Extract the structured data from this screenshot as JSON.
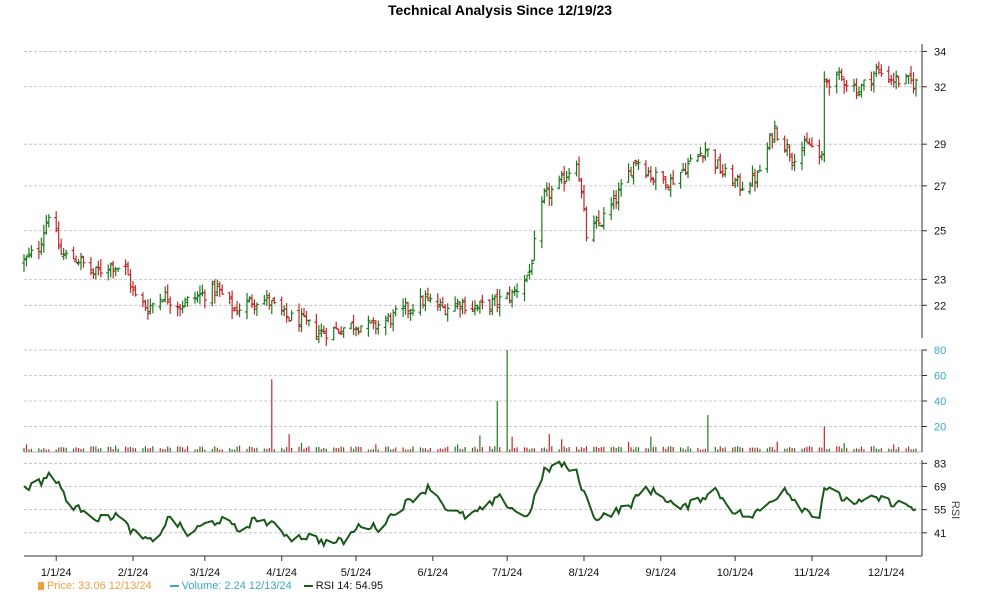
{
  "chart_data": {
    "type": "line",
    "title": "Technical Analysis Since 12/19/23",
    "x_tick_labels": [
      "1/1/24",
      "2/1/24",
      "3/1/24",
      "4/1/24",
      "5/1/24",
      "6/1/24",
      "7/1/24",
      "8/1/24",
      "9/1/24",
      "10/1/24",
      "11/1/24",
      "12/1/24"
    ],
    "price_panel": {
      "type": "ohlc",
      "y_scale": "log",
      "y_ticks": [
        22,
        23,
        25,
        27,
        29,
        32,
        34
      ],
      "ylim": [
        20.8,
        34.2
      ],
      "up_color": "#1f7a1f",
      "down_color": "#c0282a",
      "anchors": [
        [
          "12/19/23",
          23.7
        ],
        [
          "12/25/23",
          24.3
        ],
        [
          "12/29/23",
          25.8
        ],
        [
          "1/3/24",
          24.0
        ],
        [
          "1/10/24",
          23.8
        ],
        [
          "1/16/24",
          23.2
        ],
        [
          "1/23/24",
          23.6
        ],
        [
          "1/29/24",
          23.4
        ],
        [
          "2/2/24",
          22.3
        ],
        [
          "2/7/24",
          21.9
        ],
        [
          "2/13/24",
          22.4
        ],
        [
          "2/20/24",
          22.0
        ],
        [
          "2/28/24",
          22.4
        ],
        [
          "3/6/24",
          22.6
        ],
        [
          "3/13/24",
          21.8
        ],
        [
          "3/20/24",
          22.2
        ],
        [
          "3/26/24",
          22.2
        ],
        [
          "4/2/24",
          21.6
        ],
        [
          "4/9/24",
          21.4
        ],
        [
          "4/16/24",
          21.0
        ],
        [
          "4/23/24",
          21.1
        ],
        [
          "5/1/24",
          21.3
        ],
        [
          "5/8/24",
          21.2
        ],
        [
          "5/15/24",
          21.5
        ],
        [
          "5/22/24",
          21.9
        ],
        [
          "5/29/24",
          22.2
        ],
        [
          "6/5/24",
          21.9
        ],
        [
          "6/12/24",
          22.1
        ],
        [
          "6/19/24",
          21.9
        ],
        [
          "6/26/24",
          22.1
        ],
        [
          "7/3/24",
          22.4
        ],
        [
          "7/10/24",
          23.3
        ],
        [
          "7/16/24",
          26.5
        ],
        [
          "7/22/24",
          27.0
        ],
        [
          "7/29/24",
          28.3
        ],
        [
          "8/2/24",
          24.8
        ],
        [
          "8/8/24",
          25.4
        ],
        [
          "8/15/24",
          26.6
        ],
        [
          "8/22/24",
          28.3
        ],
        [
          "8/29/24",
          27.4
        ],
        [
          "9/5/24",
          27.2
        ],
        [
          "9/12/24",
          28.0
        ],
        [
          "9/19/24",
          28.8
        ],
        [
          "9/26/24",
          27.6
        ],
        [
          "10/3/24",
          27.0
        ],
        [
          "10/10/24",
          27.4
        ],
        [
          "10/17/24",
          29.8
        ],
        [
          "10/24/24",
          28.4
        ],
        [
          "10/31/24",
          29.0
        ],
        [
          "11/5/24",
          28.2
        ],
        [
          "11/6/24",
          32.3
        ],
        [
          "11/13/24",
          32.5
        ],
        [
          "11/20/24",
          31.8
        ],
        [
          "11/27/24",
          32.9
        ],
        [
          "12/4/24",
          32.4
        ],
        [
          "12/13/24",
          32.2
        ]
      ]
    },
    "volume_panel": {
      "type": "bar",
      "y_ticks": [
        20,
        40,
        60,
        80
      ],
      "ylim": [
        0,
        80
      ],
      "baseline": 1.8,
      "spikes": [
        [
          "12/20/23",
          6
        ],
        [
          "1/25/24",
          5
        ],
        [
          "2/10/24",
          6
        ],
        [
          "3/15/24",
          5
        ],
        [
          "3/28/24",
          57
        ],
        [
          "3/31/24",
          17
        ],
        [
          "4/4/24",
          14
        ],
        [
          "4/7/24",
          14
        ],
        [
          "4/9/24",
          7
        ],
        [
          "5/9/24",
          6
        ],
        [
          "6/11/24",
          6
        ],
        [
          "6/20/24",
          13
        ],
        [
          "6/27/24",
          40
        ],
        [
          "7/1/24",
          80
        ],
        [
          "7/3/24",
          12
        ],
        [
          "7/18/24",
          14
        ],
        [
          "7/23/24",
          10
        ],
        [
          "8/19/24",
          8
        ],
        [
          "8/28/24",
          12
        ],
        [
          "9/20/24",
          29
        ],
        [
          "10/18/24",
          8
        ],
        [
          "11/6/24",
          20
        ],
        [
          "11/14/24",
          7
        ],
        [
          "12/4/24",
          6
        ]
      ]
    },
    "rsi_panel": {
      "type": "line",
      "y_ticks": [
        41,
        55,
        69,
        83
      ],
      "ylim": [
        27,
        85
      ],
      "y_label": "RSI",
      "line_color": "#1a5a1a",
      "anchors": [
        [
          "12/19/23",
          68
        ],
        [
          "12/26/23",
          72
        ],
        [
          "12/29/23",
          77
        ],
        [
          "1/3/24",
          68
        ],
        [
          "1/8/24",
          55
        ],
        [
          "1/12/24",
          56
        ],
        [
          "1/18/24",
          49
        ],
        [
          "1/25/24",
          52
        ],
        [
          "2/2/24",
          40
        ],
        [
          "2/9/24",
          35
        ],
        [
          "2/16/24",
          51
        ],
        [
          "2/23/24",
          40
        ],
        [
          "3/1/24",
          46
        ],
        [
          "3/8/24",
          49
        ],
        [
          "3/15/24",
          42
        ],
        [
          "3/22/24",
          50
        ],
        [
          "3/29/24",
          45
        ],
        [
          "4/5/24",
          38
        ],
        [
          "4/12/24",
          39
        ],
        [
          "4/19/24",
          35
        ],
        [
          "4/26/24",
          36
        ],
        [
          "5/3/24",
          46
        ],
        [
          "5/10/24",
          44
        ],
        [
          "5/17/24",
          54
        ],
        [
          "5/24/24",
          62
        ],
        [
          "5/31/24",
          69
        ],
        [
          "6/7/24",
          55
        ],
        [
          "6/14/24",
          51
        ],
        [
          "6/21/24",
          55
        ],
        [
          "6/28/24",
          62
        ],
        [
          "7/3/24",
          56
        ],
        [
          "7/9/24",
          50
        ],
        [
          "7/16/24",
          78
        ],
        [
          "7/22/24",
          83
        ],
        [
          "7/29/24",
          77
        ],
        [
          "8/5/24",
          50
        ],
        [
          "8/12/24",
          53
        ],
        [
          "8/19/24",
          57
        ],
        [
          "8/26/24",
          68
        ],
        [
          "9/2/24",
          63
        ],
        [
          "9/9/24",
          55
        ],
        [
          "9/16/24",
          61
        ],
        [
          "9/23/24",
          67
        ],
        [
          "9/30/24",
          55
        ],
        [
          "10/7/24",
          50
        ],
        [
          "10/14/24",
          58
        ],
        [
          "10/21/24",
          68
        ],
        [
          "10/28/24",
          56
        ],
        [
          "11/4/24",
          51
        ],
        [
          "11/6/24",
          69
        ],
        [
          "11/13/24",
          62
        ],
        [
          "11/20/24",
          59
        ],
        [
          "11/27/24",
          62
        ],
        [
          "12/4/24",
          59
        ],
        [
          "12/9/24",
          58
        ],
        [
          "12/13/24",
          55
        ]
      ]
    }
  },
  "legend": {
    "price_label": "Price: 33.06  12/13/24",
    "volume_label": "Volume: 2.24  12/13/24",
    "rsi_label": "RSI 14: 54.95",
    "price_color": "#f0a040",
    "volume_color": "#3aa6c8",
    "rsi_color": "#111111"
  }
}
